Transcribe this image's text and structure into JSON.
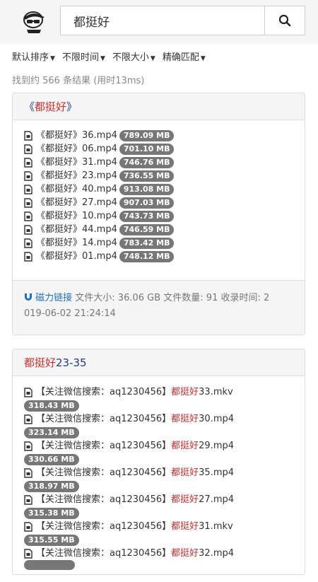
{
  "search": {
    "value": "都挺好"
  },
  "filters": [
    "默认排序",
    "不限时间",
    "不限大小",
    "精确匹配"
  ],
  "result_count": "找到约 566 条结果 (用时13ms)",
  "card1": {
    "title_prefix": "《",
    "title_highlight": "都挺好",
    "title_suffix": "》",
    "files": [
      {
        "pre": "《都挺好》36.mp4",
        "size": "789.09 MB"
      },
      {
        "pre": "《都挺好》06.mp4",
        "size": "701.10 MB"
      },
      {
        "pre": "《都挺好》31.mp4",
        "size": "746.76 MB"
      },
      {
        "pre": "《都挺好》23.mp4",
        "size": "736.55 MB"
      },
      {
        "pre": "《都挺好》40.mp4",
        "size": "913.08 MB"
      },
      {
        "pre": "《都挺好》27.mp4",
        "size": "907.03 MB"
      },
      {
        "pre": "《都挺好》10.mp4",
        "size": "743.73 MB"
      },
      {
        "pre": "《都挺好》44.mp4",
        "size": "746.59 MB"
      },
      {
        "pre": "《都挺好》14.mp4",
        "size": "783.42 MB"
      },
      {
        "pre": "《都挺好》01.mp4",
        "size": "748.12 MB"
      }
    ],
    "magnet_label": "磁力链接",
    "meta_line1": "文件大小: 36.06 GB 文件数量: 91 收录时间: 2",
    "meta_line2": "019-06-02 21:24:14"
  },
  "card2": {
    "title_highlight": "都挺好",
    "title_suffix": "23-35",
    "files": [
      {
        "prefix": "【关注微信搜索：aq1230456】",
        "hl": "都挺好",
        "name": "33.mkv",
        "size": "318.43 MB"
      },
      {
        "prefix": "【关注微信搜索：aq1230456】",
        "hl": "都挺好",
        "name": "30.mp4",
        "size": "323.14 MB"
      },
      {
        "prefix": "【关注微信搜索：aq1230456】",
        "hl": "都挺好",
        "name": "29.mp4",
        "size": "330.66 MB"
      },
      {
        "prefix": "【关注微信搜索：aq1230456】",
        "hl": "都挺好",
        "name": "35.mp4",
        "size": "318.97 MB"
      },
      {
        "prefix": "【关注微信搜索：aq1230456】",
        "hl": "都挺好",
        "name": "27.mp4",
        "size": "315.38 MB"
      },
      {
        "prefix": "【关注微信搜索：aq1230456】",
        "hl": "都挺好",
        "name": "31.mkv",
        "size": "315.55 MB"
      },
      {
        "prefix": "【关注微信搜索：aq1230456】",
        "hl": "都挺好",
        "name": "32.mp4",
        "size": ""
      }
    ]
  }
}
